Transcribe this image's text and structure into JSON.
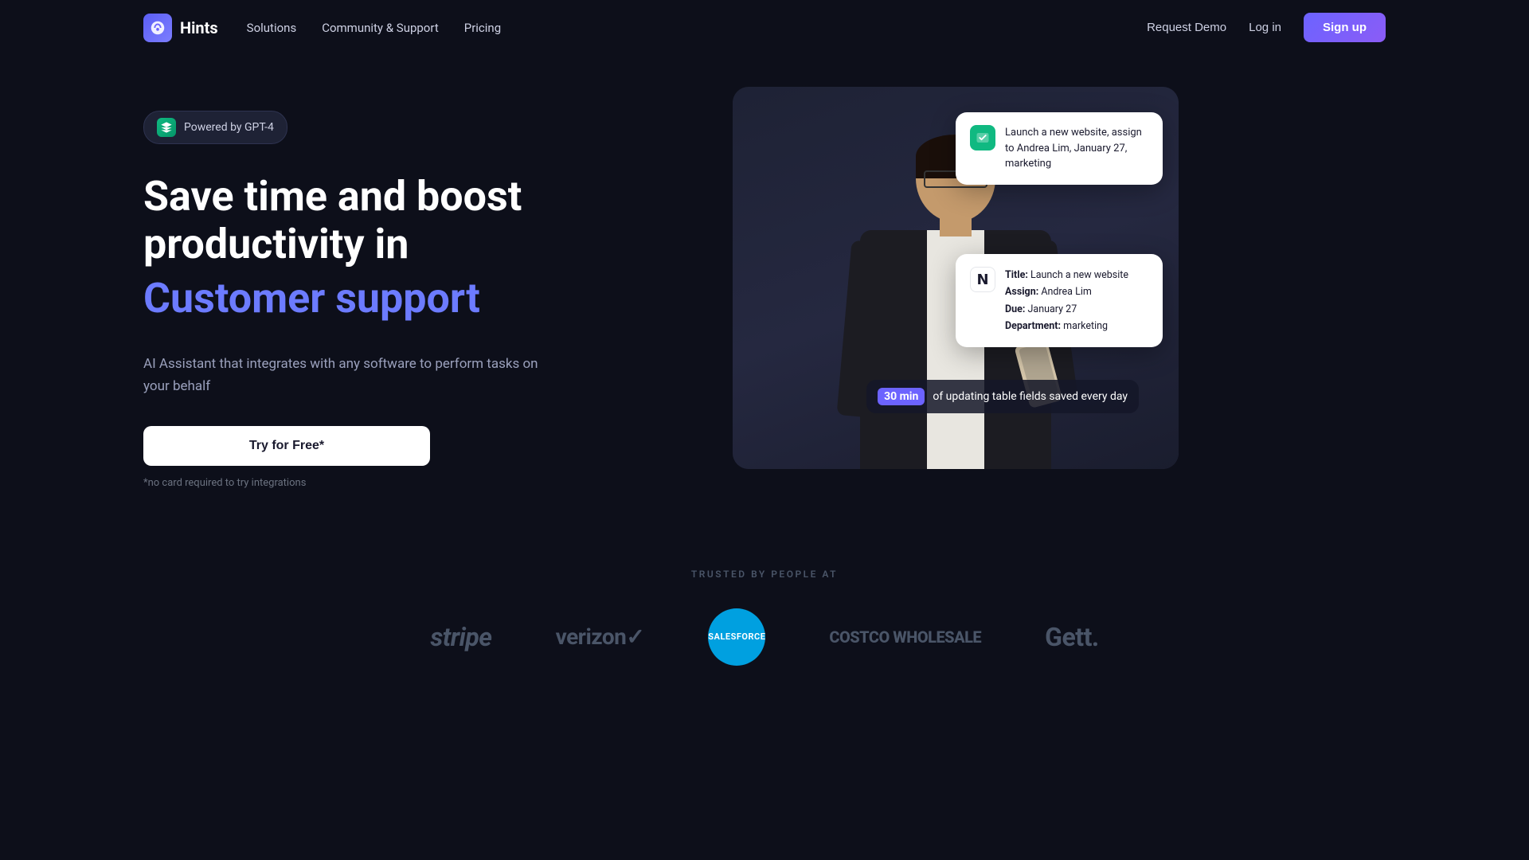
{
  "navbar": {
    "logo_text": "Hints",
    "nav_links": [
      {
        "label": "Solutions",
        "id": "solutions"
      },
      {
        "label": "Community & Support",
        "id": "community"
      },
      {
        "label": "Pricing",
        "id": "pricing"
      }
    ],
    "request_demo": "Request Demo",
    "login": "Log in",
    "signup": "Sign up"
  },
  "hero": {
    "badge_text": "Powered by GPT-4",
    "headline_line1": "Save time and boost",
    "headline_line2": "productivity in",
    "headline_accent": "Customer support",
    "description": "AI Assistant that integrates with any software to perform tasks on your behalf",
    "cta_button": "Try for Free*",
    "cta_note": "*no card required to try integrations"
  },
  "task_card_1": {
    "text": "Launch a new website, assign to Andrea Lim, January 27, marketing"
  },
  "task_card_2": {
    "title_label": "Title:",
    "title_value": "Launch a new website",
    "assign_label": "Assign:",
    "assign_value": "Andrea Lim",
    "due_label": "Due:",
    "due_value": "January 27",
    "dept_label": "Department:",
    "dept_value": "marketing"
  },
  "time_badge": {
    "highlight": "30 min",
    "text": "of updating table fields saved every day"
  },
  "trusted": {
    "label": "TRUSTED BY PEOPLE AT",
    "companies": [
      {
        "name": "stripe",
        "display": "stripe"
      },
      {
        "name": "verizon",
        "display": "verizon✓"
      },
      {
        "name": "salesforce",
        "display": "salesforce"
      },
      {
        "name": "costco",
        "display": "COSTCO WHOLESALE"
      },
      {
        "name": "gett",
        "display": "Gett."
      }
    ]
  }
}
